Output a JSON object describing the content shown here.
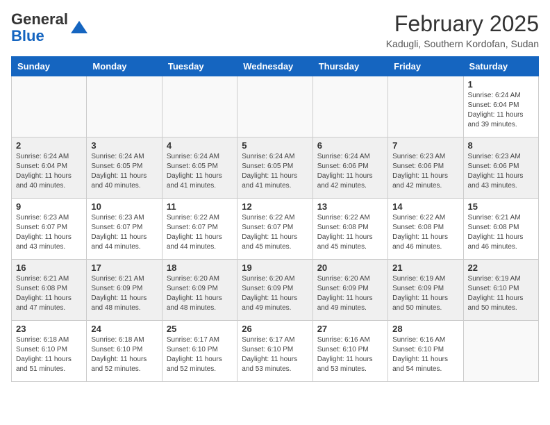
{
  "header": {
    "logo_general": "General",
    "logo_blue": "Blue",
    "month_title": "February 2025",
    "location": "Kadugli, Southern Kordofan, Sudan"
  },
  "days_of_week": [
    "Sunday",
    "Monday",
    "Tuesday",
    "Wednesday",
    "Thursday",
    "Friday",
    "Saturday"
  ],
  "weeks": [
    [
      {
        "day": "",
        "info": ""
      },
      {
        "day": "",
        "info": ""
      },
      {
        "day": "",
        "info": ""
      },
      {
        "day": "",
        "info": ""
      },
      {
        "day": "",
        "info": ""
      },
      {
        "day": "",
        "info": ""
      },
      {
        "day": "1",
        "info": "Sunrise: 6:24 AM\nSunset: 6:04 PM\nDaylight: 11 hours and 39 minutes."
      }
    ],
    [
      {
        "day": "2",
        "info": "Sunrise: 6:24 AM\nSunset: 6:04 PM\nDaylight: 11 hours and 40 minutes."
      },
      {
        "day": "3",
        "info": "Sunrise: 6:24 AM\nSunset: 6:05 PM\nDaylight: 11 hours and 40 minutes."
      },
      {
        "day": "4",
        "info": "Sunrise: 6:24 AM\nSunset: 6:05 PM\nDaylight: 11 hours and 41 minutes."
      },
      {
        "day": "5",
        "info": "Sunrise: 6:24 AM\nSunset: 6:05 PM\nDaylight: 11 hours and 41 minutes."
      },
      {
        "day": "6",
        "info": "Sunrise: 6:24 AM\nSunset: 6:06 PM\nDaylight: 11 hours and 42 minutes."
      },
      {
        "day": "7",
        "info": "Sunrise: 6:23 AM\nSunset: 6:06 PM\nDaylight: 11 hours and 42 minutes."
      },
      {
        "day": "8",
        "info": "Sunrise: 6:23 AM\nSunset: 6:06 PM\nDaylight: 11 hours and 43 minutes."
      }
    ],
    [
      {
        "day": "9",
        "info": "Sunrise: 6:23 AM\nSunset: 6:07 PM\nDaylight: 11 hours and 43 minutes."
      },
      {
        "day": "10",
        "info": "Sunrise: 6:23 AM\nSunset: 6:07 PM\nDaylight: 11 hours and 44 minutes."
      },
      {
        "day": "11",
        "info": "Sunrise: 6:22 AM\nSunset: 6:07 PM\nDaylight: 11 hours and 44 minutes."
      },
      {
        "day": "12",
        "info": "Sunrise: 6:22 AM\nSunset: 6:07 PM\nDaylight: 11 hours and 45 minutes."
      },
      {
        "day": "13",
        "info": "Sunrise: 6:22 AM\nSunset: 6:08 PM\nDaylight: 11 hours and 45 minutes."
      },
      {
        "day": "14",
        "info": "Sunrise: 6:22 AM\nSunset: 6:08 PM\nDaylight: 11 hours and 46 minutes."
      },
      {
        "day": "15",
        "info": "Sunrise: 6:21 AM\nSunset: 6:08 PM\nDaylight: 11 hours and 46 minutes."
      }
    ],
    [
      {
        "day": "16",
        "info": "Sunrise: 6:21 AM\nSunset: 6:08 PM\nDaylight: 11 hours and 47 minutes."
      },
      {
        "day": "17",
        "info": "Sunrise: 6:21 AM\nSunset: 6:09 PM\nDaylight: 11 hours and 48 minutes."
      },
      {
        "day": "18",
        "info": "Sunrise: 6:20 AM\nSunset: 6:09 PM\nDaylight: 11 hours and 48 minutes."
      },
      {
        "day": "19",
        "info": "Sunrise: 6:20 AM\nSunset: 6:09 PM\nDaylight: 11 hours and 49 minutes."
      },
      {
        "day": "20",
        "info": "Sunrise: 6:20 AM\nSunset: 6:09 PM\nDaylight: 11 hours and 49 minutes."
      },
      {
        "day": "21",
        "info": "Sunrise: 6:19 AM\nSunset: 6:09 PM\nDaylight: 11 hours and 50 minutes."
      },
      {
        "day": "22",
        "info": "Sunrise: 6:19 AM\nSunset: 6:10 PM\nDaylight: 11 hours and 50 minutes."
      }
    ],
    [
      {
        "day": "23",
        "info": "Sunrise: 6:18 AM\nSunset: 6:10 PM\nDaylight: 11 hours and 51 minutes."
      },
      {
        "day": "24",
        "info": "Sunrise: 6:18 AM\nSunset: 6:10 PM\nDaylight: 11 hours and 52 minutes."
      },
      {
        "day": "25",
        "info": "Sunrise: 6:17 AM\nSunset: 6:10 PM\nDaylight: 11 hours and 52 minutes."
      },
      {
        "day": "26",
        "info": "Sunrise: 6:17 AM\nSunset: 6:10 PM\nDaylight: 11 hours and 53 minutes."
      },
      {
        "day": "27",
        "info": "Sunrise: 6:16 AM\nSunset: 6:10 PM\nDaylight: 11 hours and 53 minutes."
      },
      {
        "day": "28",
        "info": "Sunrise: 6:16 AM\nSunset: 6:10 PM\nDaylight: 11 hours and 54 minutes."
      },
      {
        "day": "",
        "info": ""
      }
    ]
  ]
}
